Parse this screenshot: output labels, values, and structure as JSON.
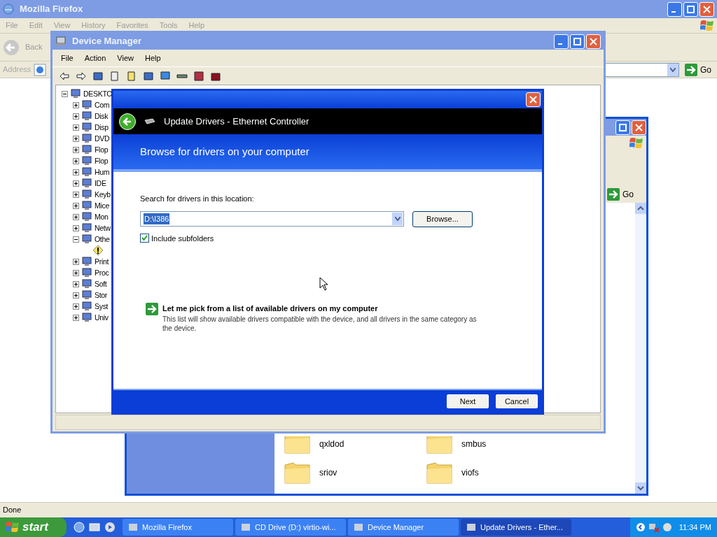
{
  "browser": {
    "title": "Mozilla Firefox",
    "menu": [
      "File",
      "Edit",
      "View",
      "History",
      "Favorites",
      "Tools",
      "Help"
    ],
    "back": "Back",
    "address_label": "Address",
    "go": "Go",
    "status": "Done"
  },
  "explorer": {
    "go": "Go",
    "folders": [
      "qxldod",
      "smbus",
      "sriov",
      "viofs"
    ]
  },
  "device_manager": {
    "title": "Device Manager",
    "menu": [
      "File",
      "Action",
      "View",
      "Help"
    ],
    "tree": {
      "label": "DESKTO",
      "expanded": true,
      "children": [
        {
          "label": "Com",
          "expanded": false
        },
        {
          "label": "Disk",
          "expanded": false
        },
        {
          "label": "Disp",
          "expanded": false
        },
        {
          "label": "DVD",
          "expanded": false
        },
        {
          "label": "Flop",
          "expanded": false
        },
        {
          "label": "Flop",
          "expanded": false
        },
        {
          "label": "Hum",
          "expanded": false
        },
        {
          "label": "IDE",
          "expanded": false
        },
        {
          "label": "Keyb",
          "expanded": false
        },
        {
          "label": "Mice",
          "expanded": false
        },
        {
          "label": "Mon",
          "expanded": false
        },
        {
          "label": "Netw",
          "expanded": false
        },
        {
          "label": "Othe",
          "expanded": true,
          "children": [
            {
              "kind": "warning"
            }
          ]
        },
        {
          "label": "Print",
          "expanded": false
        },
        {
          "label": "Proc",
          "expanded": false
        },
        {
          "label": "Soft",
          "expanded": false
        },
        {
          "label": "Stor",
          "expanded": false
        },
        {
          "label": "Syst",
          "expanded": false
        },
        {
          "label": "Univ",
          "expanded": false
        }
      ]
    }
  },
  "dialog": {
    "header": "Update Drivers - Ethernet Controller",
    "heading": "Browse for drivers on your computer",
    "search_label": "Search for drivers in this location:",
    "location": {
      "value": "D:\\I386",
      "selected": true
    },
    "browse": "Browse...",
    "include_subfolders": {
      "label": "Include subfolders",
      "checked": true
    },
    "pick": {
      "title": "Let me pick from a list of available drivers on my computer",
      "description": "This list will show available drivers compatible with the device, and all drivers in the same category as the device."
    },
    "buttons": [
      "Next",
      "Cancel"
    ]
  },
  "taskbar": {
    "start": "start",
    "tasks": [
      {
        "label": "Mozilla Firefox",
        "selected": false
      },
      {
        "label": "CD Drive (D:) virtio-wi...",
        "selected": false
      },
      {
        "label": "Device Manager",
        "selected": false
      },
      {
        "label": "Update Drivers - Ether...",
        "selected": true
      }
    ],
    "clock": "11:34 PM"
  }
}
